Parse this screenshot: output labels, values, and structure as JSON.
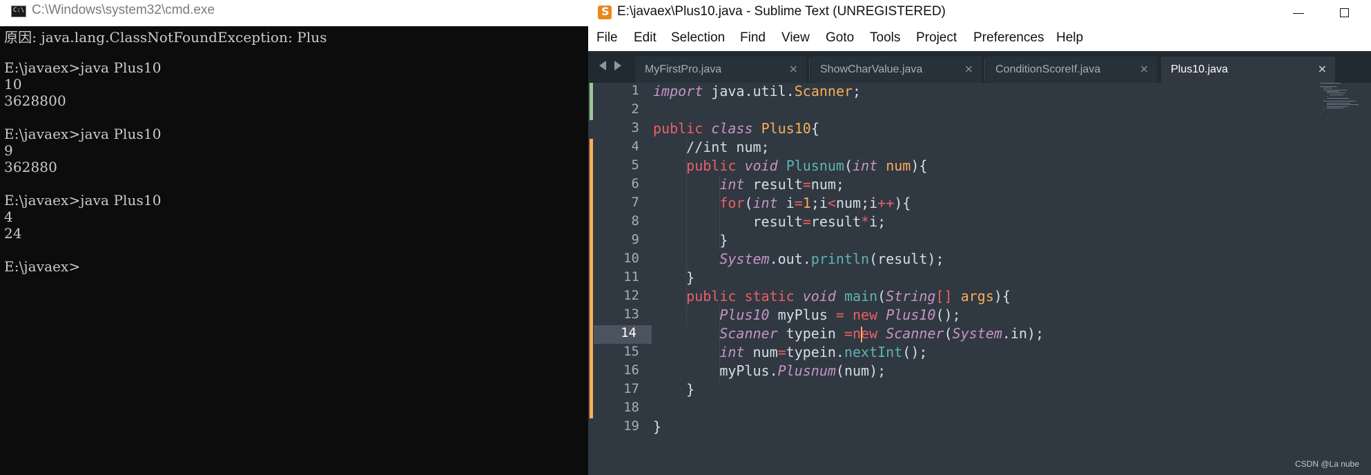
{
  "cmd": {
    "title": "C:\\Windows\\system32\\cmd.exe",
    "icon": "console-icon",
    "lines": [
      "原因: java.lang.ClassNotFoundException: Plus",
      "",
      "E:\\javaex>java Plus10",
      "10",
      "3628800",
      "",
      "E:\\javaex>java Plus10",
      "9",
      "362880",
      "",
      "E:\\javaex>java Plus10",
      "4",
      "24",
      "",
      "E:\\javaex>"
    ]
  },
  "sublime": {
    "title": "E:\\javaex\\Plus10.java - Sublime Text (UNREGISTERED)",
    "icon": "sublime-logo-icon",
    "menu": [
      "File",
      "Edit",
      "Selection",
      "Find",
      "View",
      "Goto",
      "Tools",
      "Project",
      "Preferences",
      "Help"
    ],
    "tabs": [
      {
        "label": "MyFirstPro.java",
        "close": "×",
        "active": false
      },
      {
        "label": "ShowCharValue.java",
        "close": "×",
        "active": false
      },
      {
        "label": "ConditionScoreIf.java",
        "close": "×",
        "active": false
      },
      {
        "label": "Plus10.java",
        "close": "×",
        "active": true
      }
    ],
    "current_line": 14,
    "line_numbers": [
      "1",
      "2",
      "3",
      "4",
      "5",
      "6",
      "7",
      "8",
      "9",
      "10",
      "11",
      "12",
      "13",
      "14",
      "15",
      "16",
      "17",
      "18",
      "19"
    ],
    "code_lines": [
      "import java.util.Scanner;",
      "",
      "public class Plus10{",
      "    //int num;",
      "    public void Plusnum(int num){",
      "        int result=num;",
      "        for(int i=1;i<num;i++){",
      "            result=result*i;",
      "        }",
      "        System.out.println(result);",
      "    }",
      "    public static void main(String[] args){",
      "        Plus10 myPlus = new Plus10();",
      "        Scanner typein =new Scanner(System.in);",
      "        int num=typein.nextInt();",
      "        myPlus.Plusnum(num);",
      "    }",
      "",
      "}"
    ],
    "theme_colors": {
      "background": "#303841",
      "keyword": "#c695c6",
      "storage": "#ec5f66",
      "type": "#f9ae58",
      "function": "#5fb4b4",
      "plain": "#d8dee9",
      "number": "#f9ae58",
      "operator": "#ec5f66",
      "comment": "#d8dee9",
      "gutter_modified": "#f9ae58",
      "gutter_added": "#99c794"
    }
  },
  "watermark": "CSDN @La nube"
}
